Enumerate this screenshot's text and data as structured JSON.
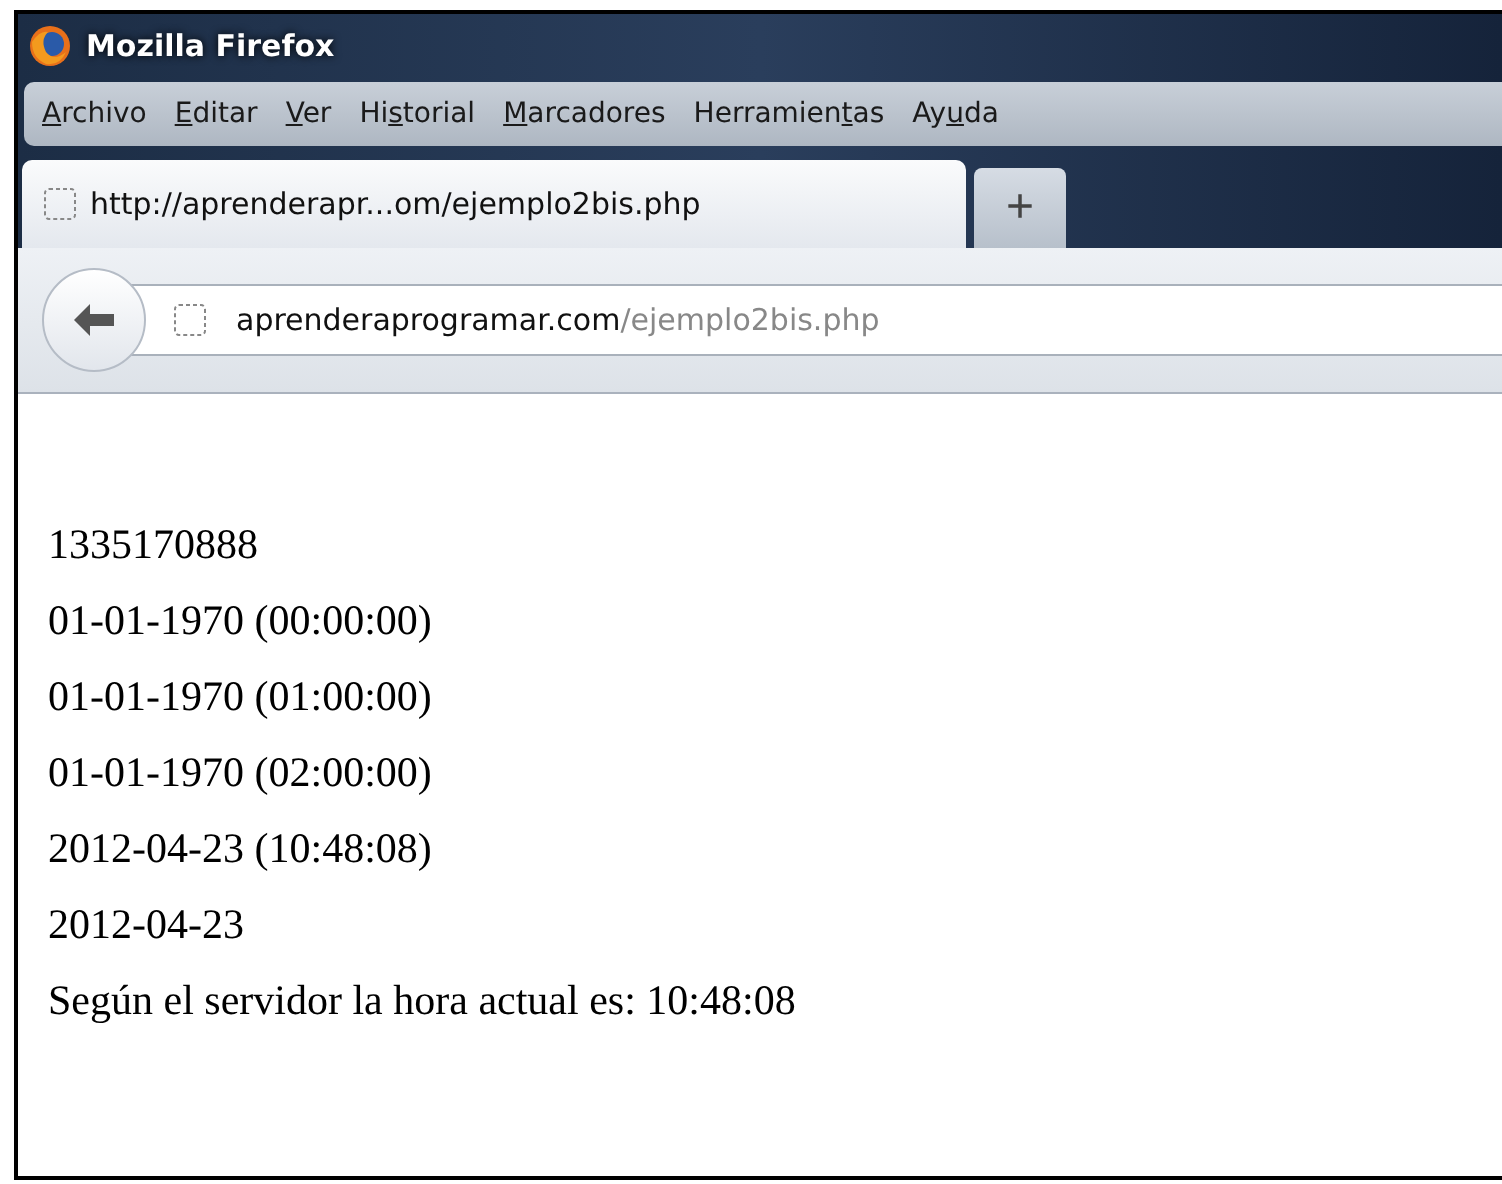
{
  "window": {
    "title": "Mozilla Firefox"
  },
  "menu": [
    {
      "key": "A",
      "post": "rchivo"
    },
    {
      "key": "E",
      "post": "ditar"
    },
    {
      "key": "V",
      "post": "er"
    },
    {
      "pre": "Hi",
      "key": "s",
      "post": "torial"
    },
    {
      "key": "M",
      "post": "arcadores"
    },
    {
      "pre": "Herramien",
      "key": "t",
      "post": "as"
    },
    {
      "pre": "Ay",
      "key": "u",
      "post": "da"
    }
  ],
  "tabs": [
    {
      "label": "http://aprenderapr...om/ejemplo2bis.php",
      "selected": true
    }
  ],
  "new_tab": "+",
  "address": {
    "host": "aprenderaprogramar.com",
    "path": "/ejemplo2bis.php"
  },
  "content": [
    "1335170888",
    "01-01-1970 (00:00:00)",
    "01-01-1970 (01:00:00)",
    "01-01-1970 (02:00:00)",
    "2012-04-23 (10:48:08)",
    "2012-04-23",
    "Según el servidor la hora actual es: 10:48:08"
  ]
}
